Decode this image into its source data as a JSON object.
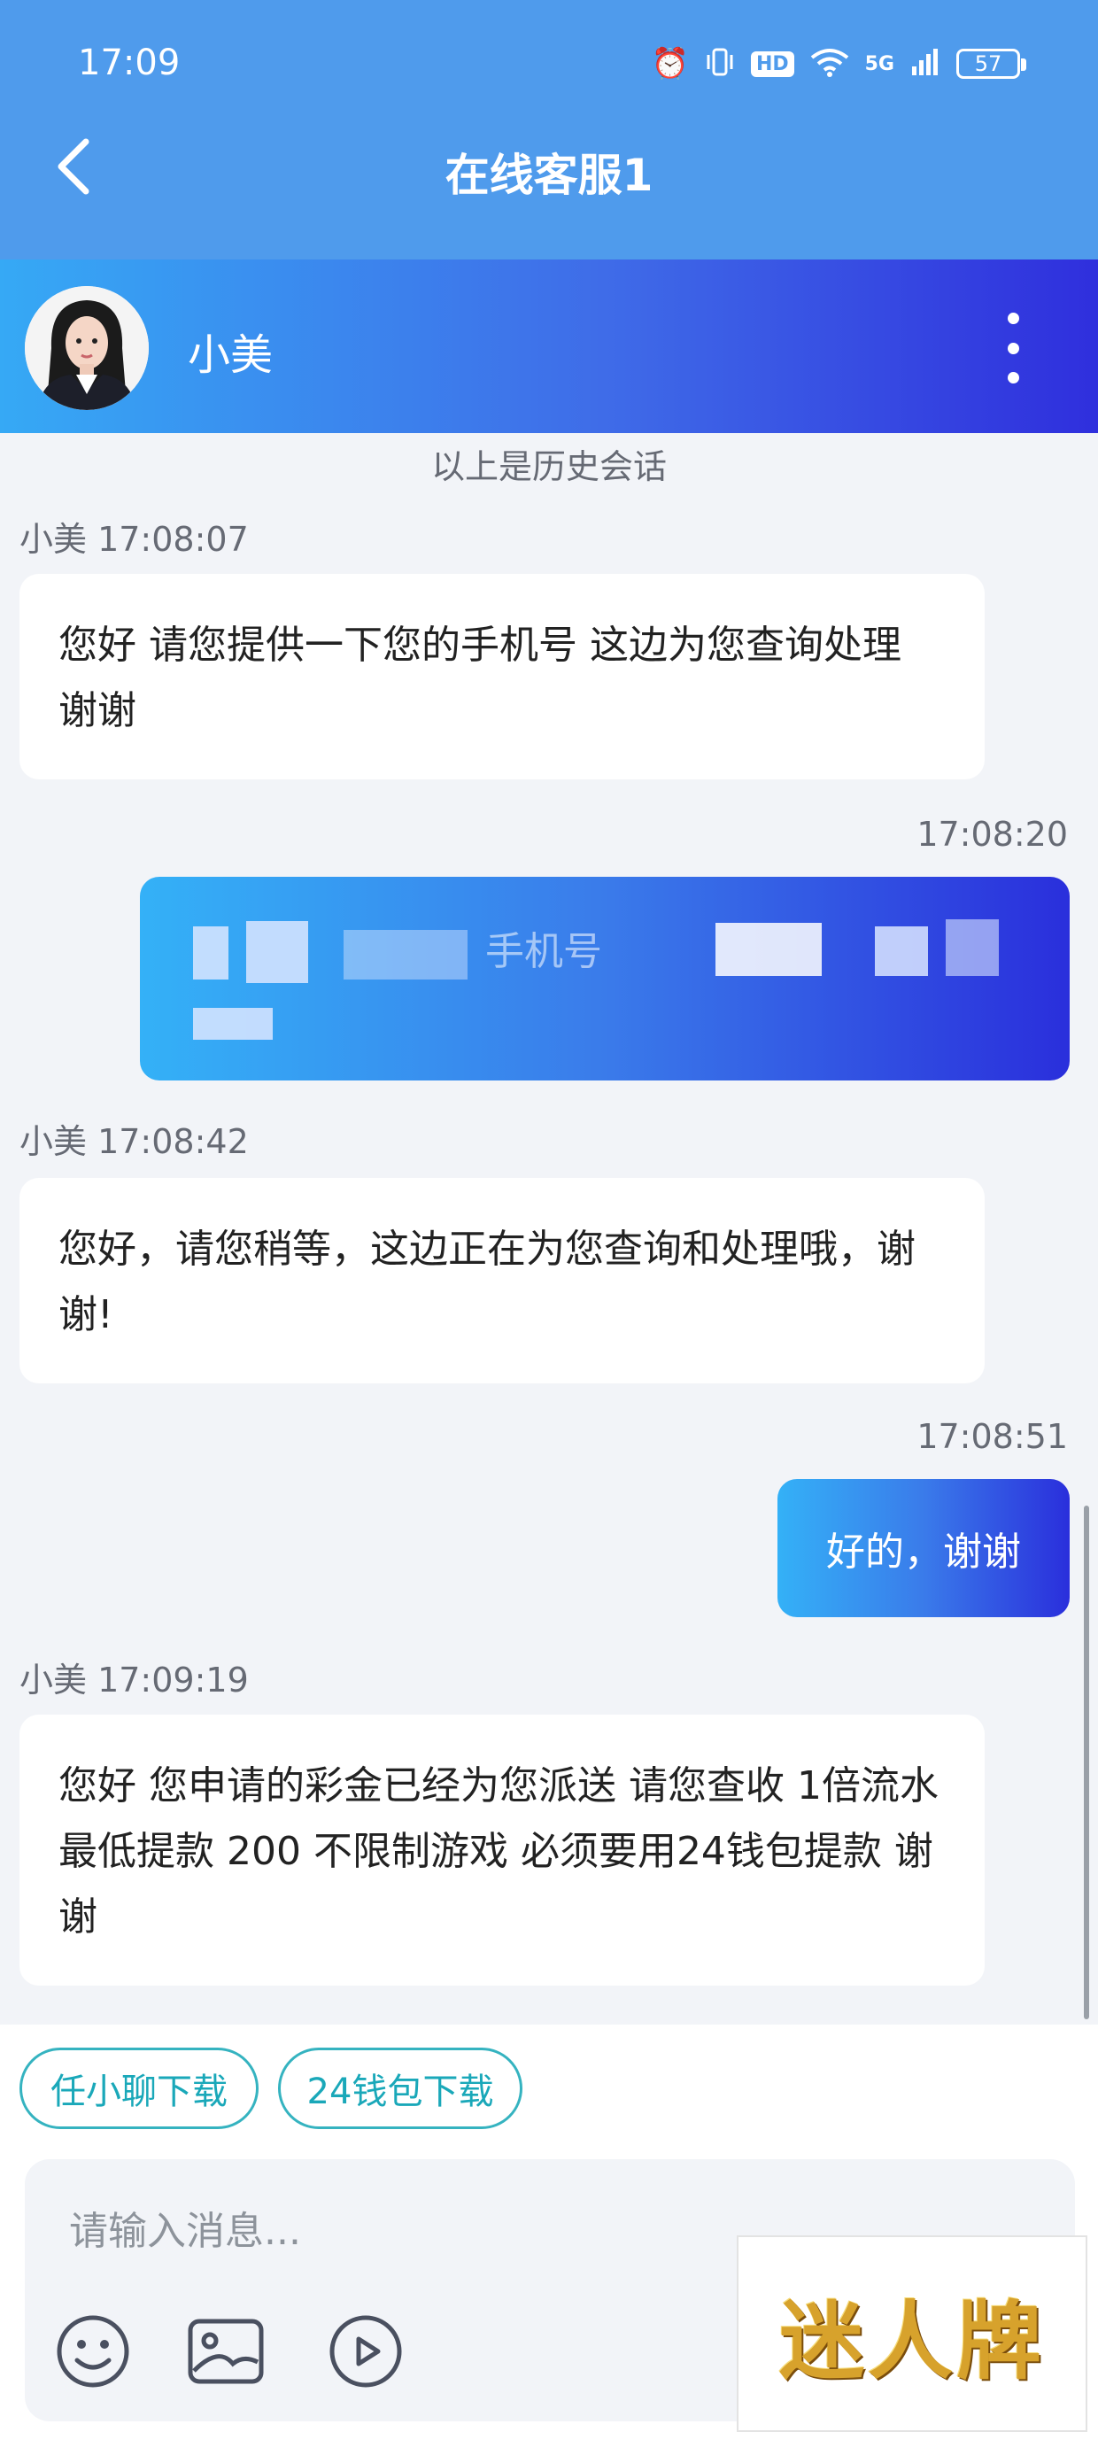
{
  "status_bar": {
    "time": "17:09",
    "hd_label": "HD",
    "network_label": "5G",
    "battery": "57"
  },
  "header": {
    "title": "在线客服1"
  },
  "agent": {
    "name": "小美"
  },
  "chat": {
    "history_note": "以上是历史会话",
    "messages": [
      {
        "side": "in",
        "meta": "小美 17:08:07",
        "text": "您好 请您提供一下您的手机号 这边为您查询处理 谢谢"
      },
      {
        "side": "out",
        "meta": "17:08:20",
        "text": "手机号",
        "redacted": true
      },
      {
        "side": "in",
        "meta": "小美 17:08:42",
        "text": "您好，请您稍等，这边正在为您查询和处理哦，谢谢!"
      },
      {
        "side": "out",
        "meta": "17:08:51",
        "text": "好的，谢谢"
      },
      {
        "side": "in",
        "meta": "小美 17:09:19",
        "text": "您好 您申请的彩金已经为您派送 请您查收 1倍流水 最低提款 200  不限制游戏  必须要用24钱包提款 谢谢"
      }
    ]
  },
  "quick_replies": [
    "任小聊下载",
    "24钱包下载"
  ],
  "composer": {
    "placeholder": "请输入消息..."
  },
  "icons": {
    "back": "chevron-left-icon",
    "more": "more-vertical-icon",
    "emoji": "smiley-icon",
    "image": "image-icon",
    "video": "play-circle-icon"
  },
  "colors": {
    "header_bg": "#4f9bec",
    "accent_chip": "#35b3c0",
    "bubble_gradient_start": "#34b1f7",
    "bubble_gradient_end": "#2a2fdc"
  },
  "watermark": {
    "text": "迷人牌"
  }
}
